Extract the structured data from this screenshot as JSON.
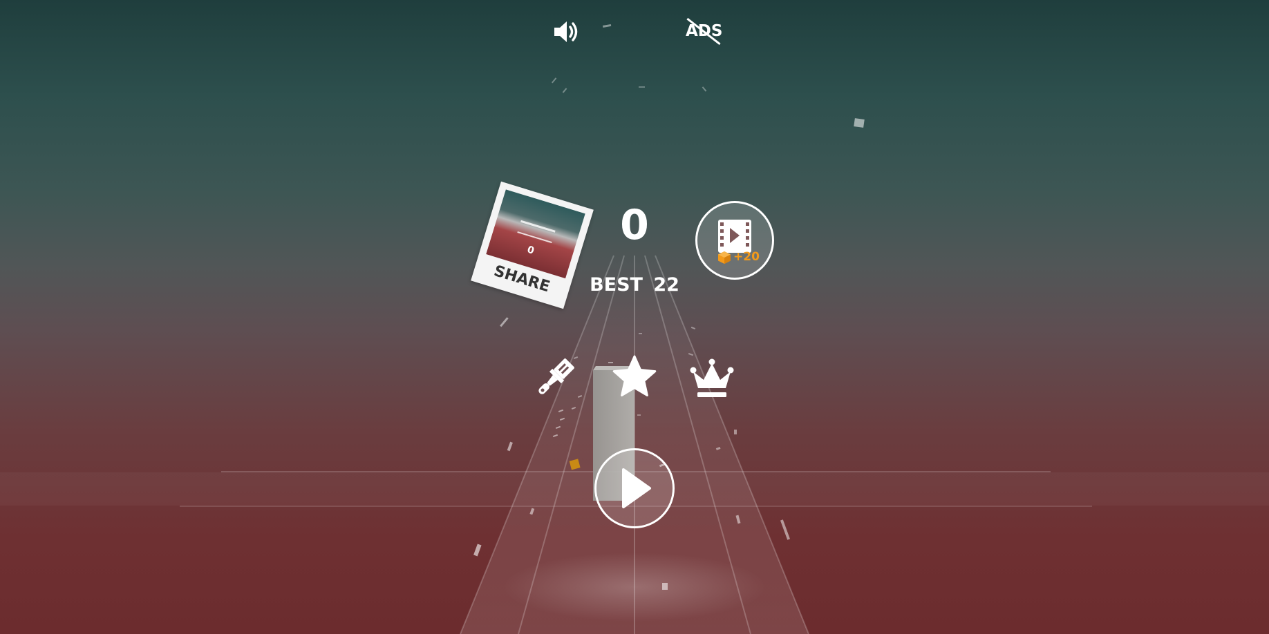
{
  "hud": {
    "sound_icon": "speaker-on-icon",
    "no_ads_label": "ADS",
    "no_ads_icon": "no-ads-icon"
  },
  "score": {
    "current": "0",
    "best_label": "BEST",
    "best_value": "22"
  },
  "share": {
    "label": "SHARE",
    "thumbnail_score": "0",
    "icon": "share-card-icon"
  },
  "reward": {
    "icon": "film-play-icon",
    "currency_icon": "orange-cube-icon",
    "amount": "+20"
  },
  "menu": {
    "paint_icon": "paintbrush-icon",
    "star_icon": "star-icon",
    "crown_icon": "crown-icon"
  },
  "play": {
    "icon": "play-icon"
  },
  "colors": {
    "sky_top": "#1f3e3d",
    "ground": "#6c2c2e",
    "accent_orange": "#f39a1a",
    "ui_white": "#ffffff"
  }
}
